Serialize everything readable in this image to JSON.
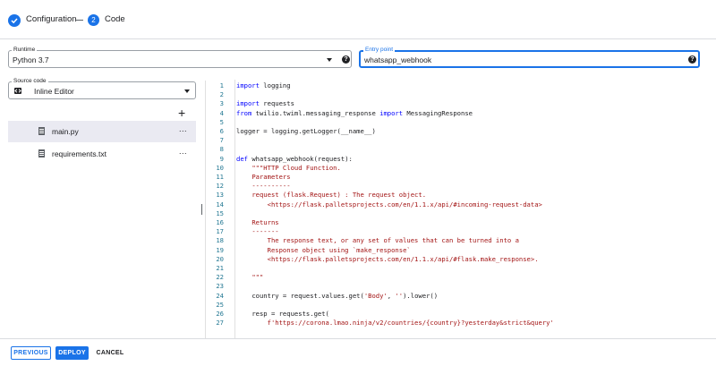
{
  "stepper": {
    "step1_label": "Configuration",
    "step2_number": "2",
    "step2_label": "Code"
  },
  "runtime": {
    "label": "Runtime",
    "value": "Python 3.7"
  },
  "entry_point": {
    "label": "Entry point",
    "value": "whatsapp_webhook"
  },
  "source_code": {
    "label": "Source code",
    "value": "Inline Editor"
  },
  "files": [
    {
      "name": "main.py",
      "more": "...",
      "active": true
    },
    {
      "name": "requirements.txt",
      "more": "...",
      "active": false
    }
  ],
  "icons": {
    "add": "+",
    "help": "?"
  },
  "code_lines": [
    {
      "n": "1",
      "text": "import logging"
    },
    {
      "n": "2",
      "text": ""
    },
    {
      "n": "3",
      "text": "import requests"
    },
    {
      "n": "4",
      "text": "from twilio.twiml.messaging_response import MessagingResponse"
    },
    {
      "n": "5",
      "text": ""
    },
    {
      "n": "6",
      "text": "logger = logging.getLogger(__name__)"
    },
    {
      "n": "7",
      "text": ""
    },
    {
      "n": "8",
      "text": ""
    },
    {
      "n": "9",
      "text": "def whatsapp_webhook(request):"
    },
    {
      "n": "10",
      "text": "    \"\"\"HTTP Cloud Function."
    },
    {
      "n": "11",
      "text": "    Parameters"
    },
    {
      "n": "12",
      "text": "    ----------"
    },
    {
      "n": "13",
      "text": "    request (flask.Request) : The request object."
    },
    {
      "n": "14",
      "text": "        <https://flask.palletsprojects.com/en/1.1.x/api/#incoming-request-data>"
    },
    {
      "n": "15",
      "text": ""
    },
    {
      "n": "16",
      "text": "    Returns"
    },
    {
      "n": "17",
      "text": "    -------"
    },
    {
      "n": "18",
      "text": "        The response text, or any set of values that can be turned into a"
    },
    {
      "n": "19",
      "text": "        Response object using `make_response`"
    },
    {
      "n": "20",
      "text": "        <https://flask.palletsprojects.com/en/1.1.x/api/#flask.make_response>."
    },
    {
      "n": "21",
      "text": ""
    },
    {
      "n": "22",
      "text": "    \"\"\""
    },
    {
      "n": "23",
      "text": ""
    },
    {
      "n": "24",
      "text": "    country = request.values.get('Body', '').lower()"
    },
    {
      "n": "25",
      "text": ""
    },
    {
      "n": "26",
      "text": "    resp = requests.get("
    },
    {
      "n": "27",
      "text": "        f'https://corona.lmao.ninja/v2/countries/{country}?yesterday&strict&query'"
    }
  ],
  "buttons": {
    "previous": "PREVIOUS",
    "deploy": "DEPLOY",
    "cancel": "CANCEL"
  },
  "colors": {
    "accent": "#1a73e8",
    "keyword": "#0000ff",
    "string": "#a31515",
    "line_number": "#237893"
  }
}
